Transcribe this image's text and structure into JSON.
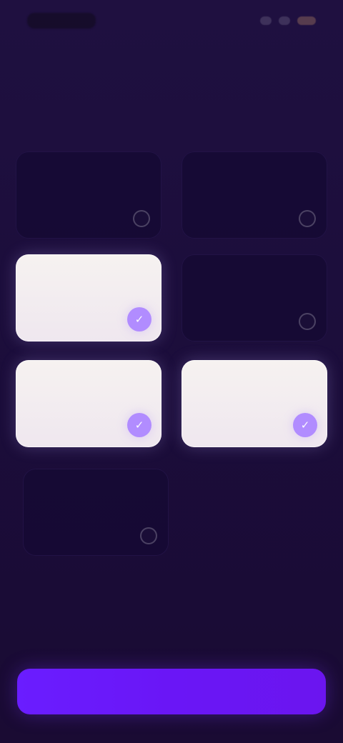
{
  "colors": {
    "background": "#1c0f3a",
    "card_unselected": "#160a34",
    "card_selected": "#f6f2f0",
    "accent": "#6a1dff",
    "check_selected": "#b18cff"
  },
  "header": {
    "title": ""
  },
  "cards": [
    {
      "label": "",
      "selected": false
    },
    {
      "label": "",
      "selected": false
    },
    {
      "label": "",
      "selected": true
    },
    {
      "label": "",
      "selected": false
    },
    {
      "label": "",
      "selected": true
    },
    {
      "label": "",
      "selected": true
    },
    {
      "label": "",
      "selected": false
    }
  ],
  "icons": {
    "check": "✓"
  },
  "footer": {
    "cta_label": ""
  }
}
